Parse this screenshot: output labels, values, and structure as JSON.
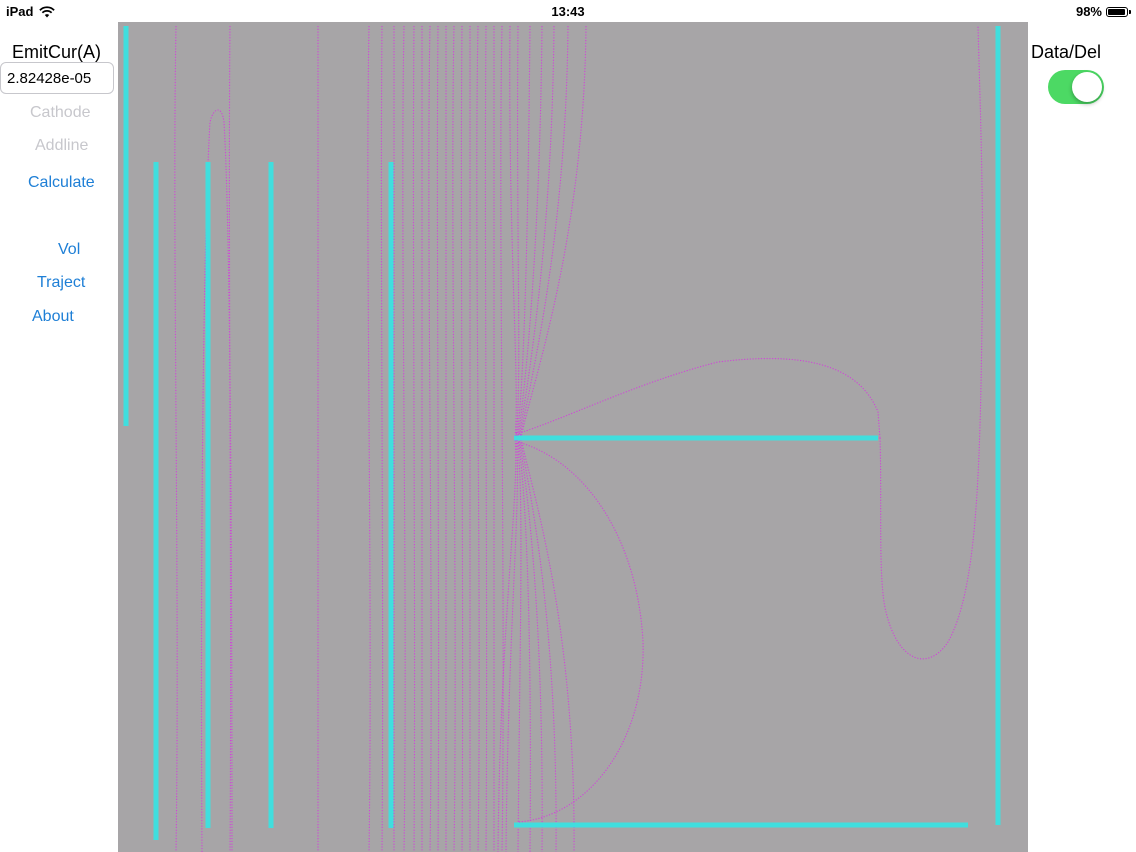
{
  "status_bar": {
    "device": "iPad",
    "time": "13:43",
    "battery": "98%",
    "battery_level": 0.98
  },
  "sidebar": {
    "emit_current_title": "EmitCur(A)",
    "emit_current_value": "2.82428e-05",
    "cathode_label": "Cathode",
    "addline_label": "Addline",
    "calculate_label": "Calculate",
    "vol_label": "Vol",
    "traject_label": "Traject",
    "about_label": "About"
  },
  "right_panel": {
    "data_del_label": "Data/Del",
    "data_del_on": true
  },
  "colors": {
    "canvas_bg": "#a7a5a7",
    "electrode": "#40dede",
    "equipotential": "#d045d8",
    "accent": "#1e7fd6",
    "toggle_on": "#4cd964"
  }
}
